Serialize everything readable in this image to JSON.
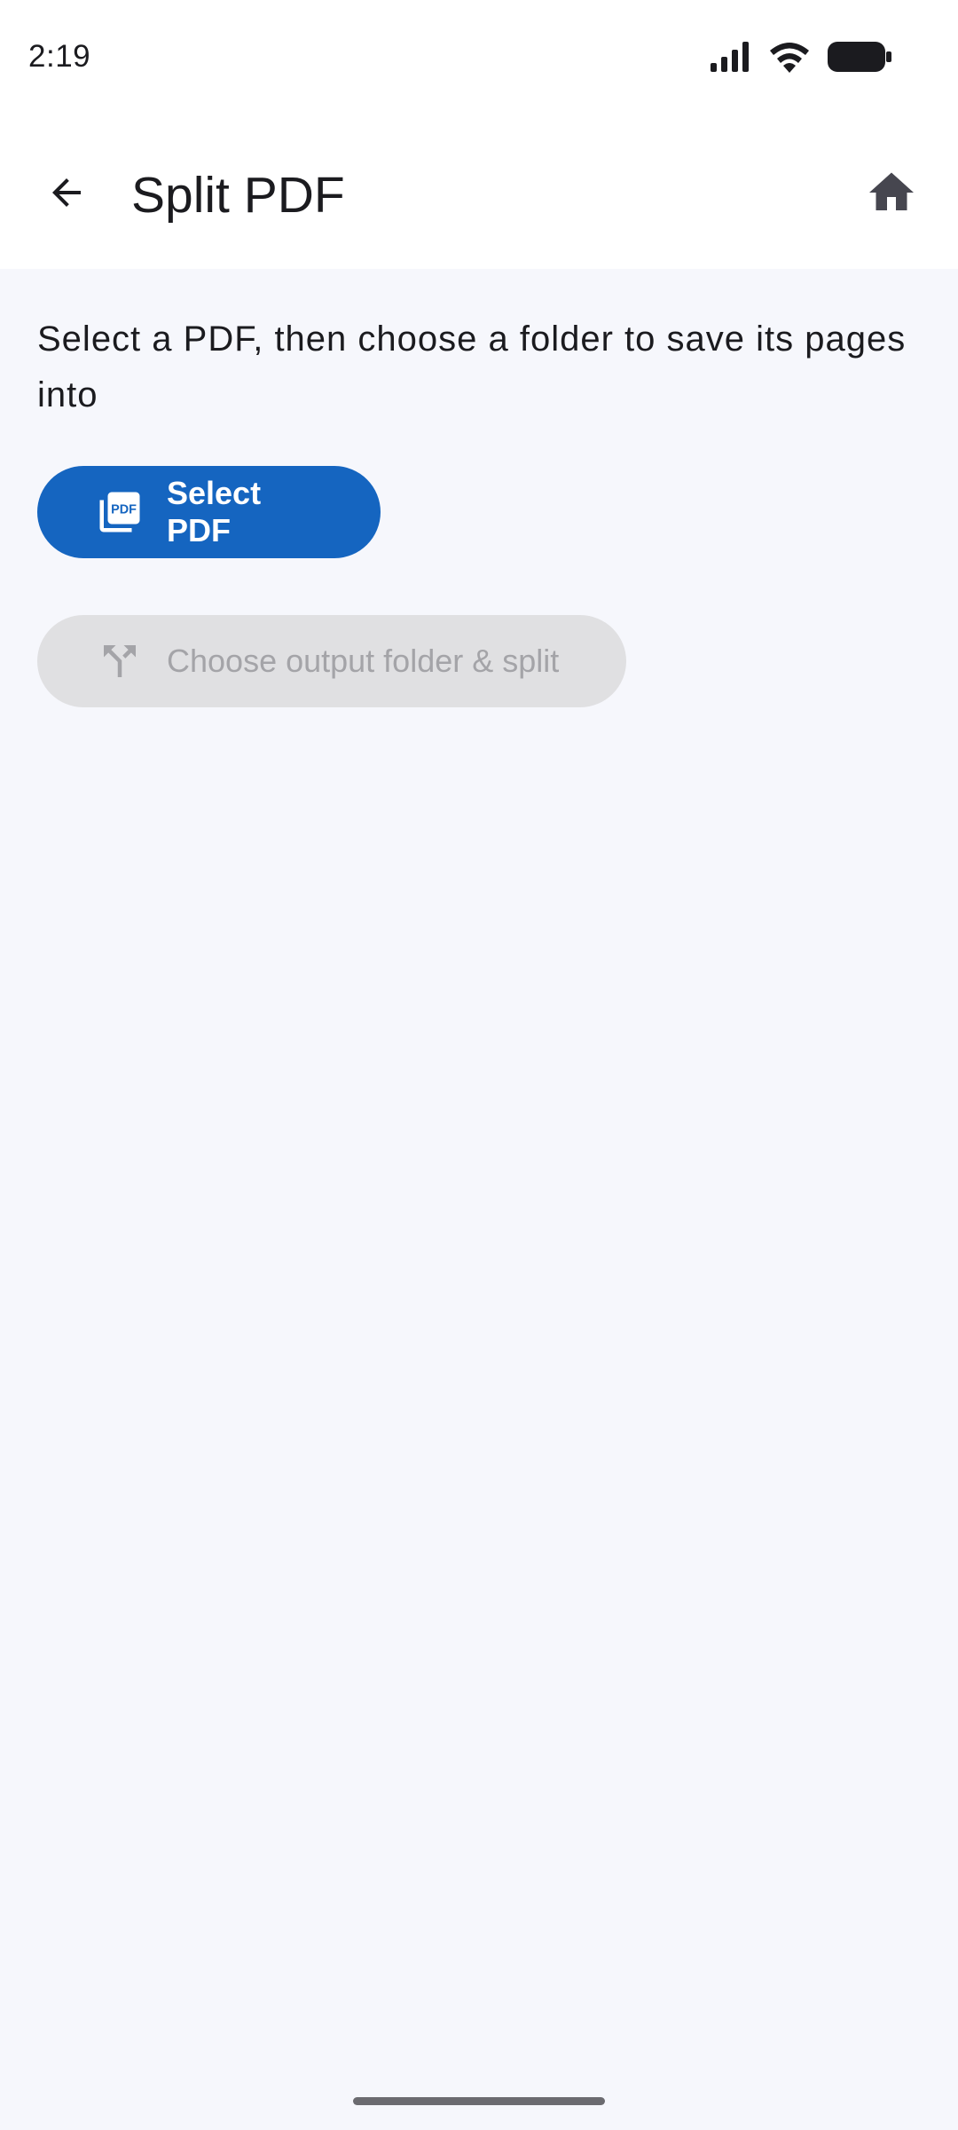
{
  "status_bar": {
    "time": "2:19"
  },
  "app_bar": {
    "title": "Split PDF",
    "back_icon": "arrow-back-icon",
    "home_icon": "home-icon"
  },
  "content": {
    "instructions": "Select a PDF, then choose a folder to save its pages into",
    "select_pdf_button": {
      "label": "Select PDF",
      "icon": "pdf-file-icon",
      "color": "#1565c0"
    },
    "split_button": {
      "label": "Choose output folder & split",
      "icon": "call-split-icon",
      "enabled": false
    }
  }
}
